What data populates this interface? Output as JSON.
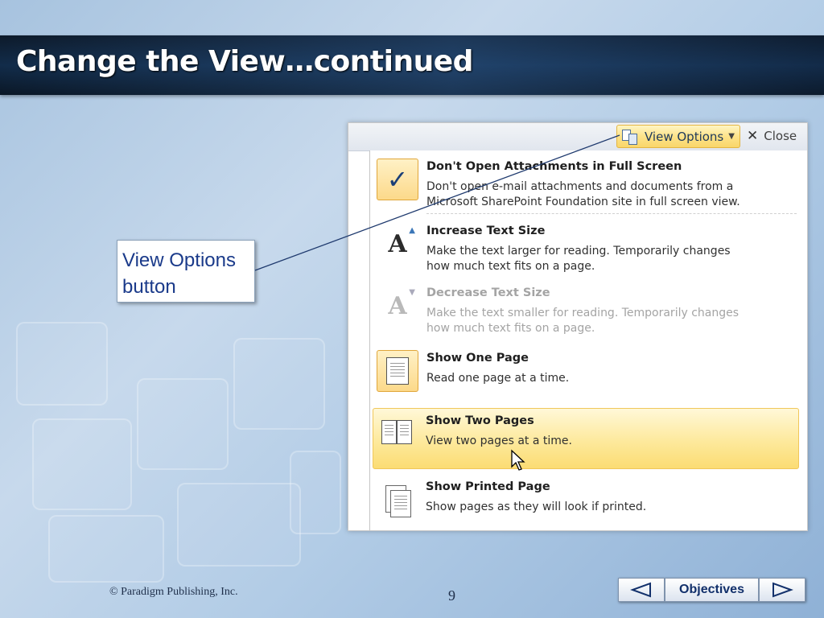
{
  "slide": {
    "title": "Change the View…continued"
  },
  "screenshot": {
    "toolbar": {
      "view_options_label": "View Options",
      "close_label": "Close"
    },
    "menu_items": [
      {
        "heading": "Don't Open Attachments in Full Screen",
        "description_line1": "Don't open e-mail attachments and documents from a",
        "description_line2": "Microsoft SharePoint Foundation site in full screen view.",
        "icon": "checkmark-icon",
        "checked": true,
        "enabled": true
      },
      {
        "heading": "Increase Text Size",
        "description_line1": "Make the text larger for reading. Temporarily changes",
        "description_line2": "how much text fits on a page.",
        "icon": "increase-text-icon",
        "enabled": true
      },
      {
        "heading": "Decrease Text Size",
        "description_line1": "Make the text smaller for reading. Temporarily changes",
        "description_line2": "how much text fits on a page.",
        "icon": "decrease-text-icon",
        "enabled": false
      },
      {
        "heading": "Show One Page",
        "description_line1": "Read one page at a time.",
        "icon": "one-page-icon",
        "checked": true,
        "enabled": true
      },
      {
        "heading": "Show Two Pages",
        "description_line1": "View two pages at a time.",
        "icon": "two-pages-icon",
        "hovered": true,
        "enabled": true
      },
      {
        "heading": "Show Printed Page",
        "description_line1": "Show pages as they will look if printed.",
        "icon": "printed-page-icon",
        "enabled": true
      }
    ]
  },
  "callout": {
    "line1": "View Options",
    "line2": "button"
  },
  "footer": {
    "copyright": "© Paradigm Publishing, Inc.",
    "page_number": "9",
    "objectives_label": "Objectives"
  },
  "colors": {
    "title_bar": "#0d1a2a",
    "highlight": "#fde99c",
    "callout_text": "#1a3a8a"
  }
}
